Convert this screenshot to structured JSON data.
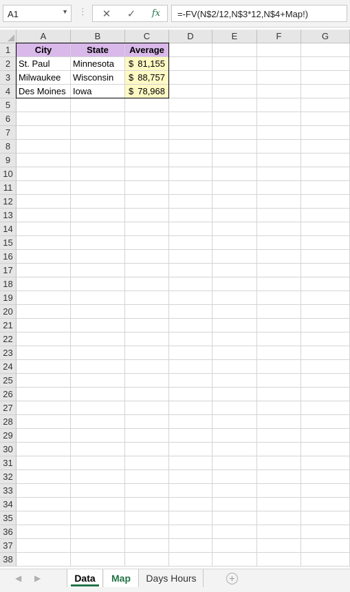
{
  "formula_bar": {
    "name_box": "A1",
    "formula": "=-FV(N$2/12,N$3*12,N$4+Map!)"
  },
  "columns": [
    "A",
    "B",
    "C",
    "D",
    "E",
    "F",
    "G"
  ],
  "rows": [
    "1",
    "2",
    "3",
    "4",
    "5",
    "6",
    "7",
    "8",
    "9",
    "10",
    "11",
    "12",
    "13",
    "14",
    "15",
    "16",
    "17",
    "18",
    "19",
    "20",
    "21",
    "22",
    "23",
    "24",
    "25",
    "26",
    "27",
    "28",
    "29",
    "30",
    "31",
    "32",
    "33",
    "34",
    "35",
    "36",
    "37",
    "38"
  ],
  "table": {
    "headers": [
      "City",
      "State",
      "Average"
    ],
    "rows": [
      {
        "city": "St. Paul",
        "state": "Minnesota",
        "currency": "$",
        "average": "81,155"
      },
      {
        "city": "Milwaukee",
        "state": "Wisconsin",
        "currency": "$",
        "average": "88,757"
      },
      {
        "city": "Des Moines",
        "state": "Iowa",
        "currency": "$",
        "average": "78,968"
      }
    ]
  },
  "sheet_tabs": [
    {
      "label": "Data",
      "active": true
    },
    {
      "label": "Map",
      "active": false
    },
    {
      "label": "Days Hours",
      "active": false
    }
  ],
  "colors": {
    "header_fill": "#d9b8ea",
    "average_fill": "#fff9c4",
    "accent": "#217346"
  },
  "icons": [
    "cancel-icon",
    "enter-icon",
    "insert-function-icon",
    "add-sheet-icon"
  ]
}
